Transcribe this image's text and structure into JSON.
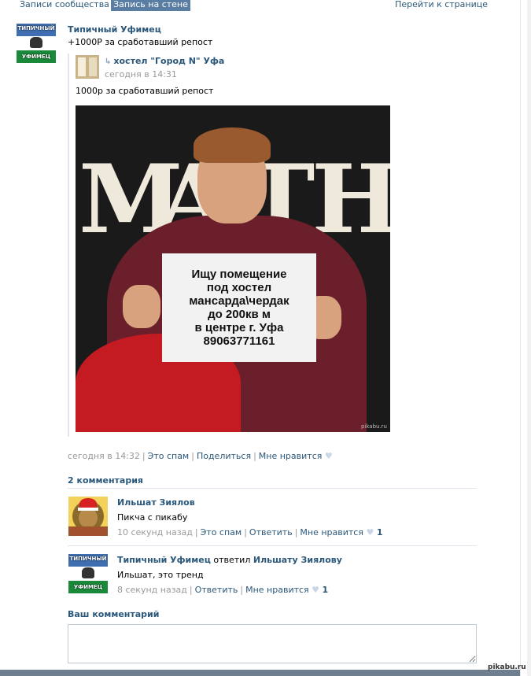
{
  "tabs": {
    "community_posts": "Записи сообщества",
    "wall_post": "Запись на стене",
    "go_to_page": "Перейти к странице"
  },
  "post": {
    "author": "Типичный Уфимец",
    "text": "+1000Р за сработавший репост",
    "avatar_text": {
      "top": "ТИПИЧНЫЙ",
      "bottom": "УФИМЕЦ"
    },
    "date": "сегодня в 14:32",
    "actions": {
      "spam": "Это спам",
      "share": "Поделиться",
      "like": "Мне нравится"
    }
  },
  "repost": {
    "author": "хостел \"Город N\" Уфа",
    "date": "сегодня в 14:31",
    "text": "1000р за сработавший репост",
    "photo": {
      "background_letters": [
        "M",
        "A",
        "T",
        "H"
      ],
      "sign_lines": [
        "Ищу помещение",
        "под хостел",
        "мансарда\\чердак",
        "до 200кв м",
        "в центре г. Уфа",
        "89063771161"
      ],
      "watermark": "pikabu.ru"
    }
  },
  "comments": {
    "header": "2 комментария",
    "items": [
      {
        "author": "Ильшат Зиялов",
        "replied_label": "",
        "reply_to": "",
        "text": "Пикча с пикабу",
        "time": "10 секунд назад",
        "spam": "Это спам",
        "reply": "Ответить",
        "like": "Мне нравится",
        "likes": "1"
      },
      {
        "author": "Типичный Уфимец",
        "replied_label": "ответил",
        "reply_to": "Ильшату Зиялову",
        "text": "Ильшат, это тренд",
        "time": "8 секунд назад",
        "spam": "",
        "reply": "Ответить",
        "like": "Мне нравится",
        "likes": "1"
      }
    ]
  },
  "your_comment": {
    "label": "Ваш комментарий",
    "value": ""
  },
  "watermark": "pikabu.ru",
  "colors": {
    "link": "#2b587a",
    "tab_active": "#597da3",
    "meta": "#999999"
  }
}
